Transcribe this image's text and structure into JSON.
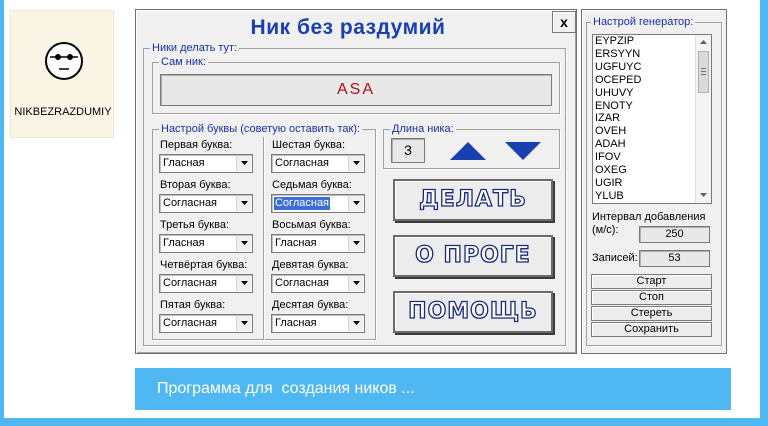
{
  "app_tile": {
    "name": "NIKBEZRAZDUMIY",
    "icon": "face-with-glasses-icon"
  },
  "window": {
    "title": "Ник без раздумий",
    "close_label": "x"
  },
  "nicks_group": {
    "legend": "Ники делать тут:"
  },
  "own_nick": {
    "legend": "Сам ник:",
    "value": "ASA"
  },
  "letters_group": {
    "legend": "Настрой буквы (советую оставить так):"
  },
  "letters": [
    {
      "label": "Первая буква:",
      "value": "Гласная"
    },
    {
      "label": "Вторая буква:",
      "value": "Согласная"
    },
    {
      "label": "Третья буква:",
      "value": "Гласная"
    },
    {
      "label": "Четвёртая буква:",
      "value": "Согласная"
    },
    {
      "label": "Пятая буква:",
      "value": "Согласная"
    },
    {
      "label": "Шестая буква:",
      "value": "Согласная"
    },
    {
      "label": "Седьмая буква:",
      "value": "Согласная",
      "selected": true
    },
    {
      "label": "Восьмая буква:",
      "value": "Гласная"
    },
    {
      "label": "Девятая буква:",
      "value": "Согласная"
    },
    {
      "label": "Десятая буква:",
      "value": "Гласная"
    }
  ],
  "length_group": {
    "legend": "Длина ника:",
    "value": "3"
  },
  "buttons": {
    "make": "ДЕЛАТЬ",
    "about": "О ПРОГЕ",
    "help": "ПОМОЩЬ"
  },
  "generator": {
    "legend": "Настрой генератор:",
    "items": [
      "EYPZIP",
      "ERSYYN",
      "UGFUYC",
      "OCEPED",
      "UHUVY",
      "ENOTY",
      "IZAR",
      "OVEH",
      "ADAH",
      "IFOV",
      "OXEG",
      "UGIR",
      "YLUB"
    ],
    "interval_label": "Интервал добавления (м/с):",
    "interval_value": "250",
    "records_label": "Записей:",
    "records_value": "53",
    "start": "Старт",
    "stop": "Стоп",
    "clear": "Стереть",
    "save": "Сохранить"
  },
  "banner": {
    "text": "Программа для  создания ников ..."
  },
  "colors": {
    "title": "#1a3fae",
    "legend": "#1a2fa0",
    "nick": "#b01010",
    "accent": "#4fb7f1",
    "arrow": "#1a3fae"
  }
}
